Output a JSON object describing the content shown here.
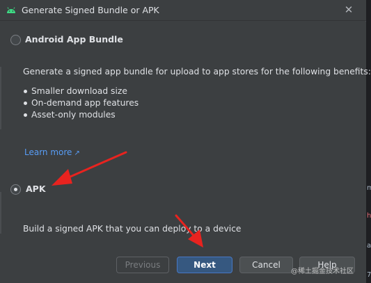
{
  "window": {
    "title": "Generate Signed Bundle or APK",
    "close_icon": "close-icon",
    "app_icon": "android-icon"
  },
  "options": {
    "bundle": {
      "label": "Android App Bundle",
      "selected": false,
      "description": "Generate a signed app bundle for upload to app stores for the following benefits:",
      "benefits": [
        "Smaller download size",
        "On-demand app features",
        "Asset-only modules"
      ],
      "learn_more": "Learn more",
      "learn_more_icon": "external-link-icon"
    },
    "apk": {
      "label": "APK",
      "selected": true,
      "description": "Build a signed APK that you can deploy to a device"
    }
  },
  "buttons": {
    "previous": "Previous",
    "next": "Next",
    "cancel": "Cancel",
    "help": "Help"
  },
  "background_fragments": [
    "m",
    "h",
    "as",
    "7"
  ],
  "watermark": "@稀土掘金技术社区",
  "colors": {
    "link": "#589df6",
    "primary_button": "#365880",
    "annotation_arrow": "#e8231f"
  }
}
